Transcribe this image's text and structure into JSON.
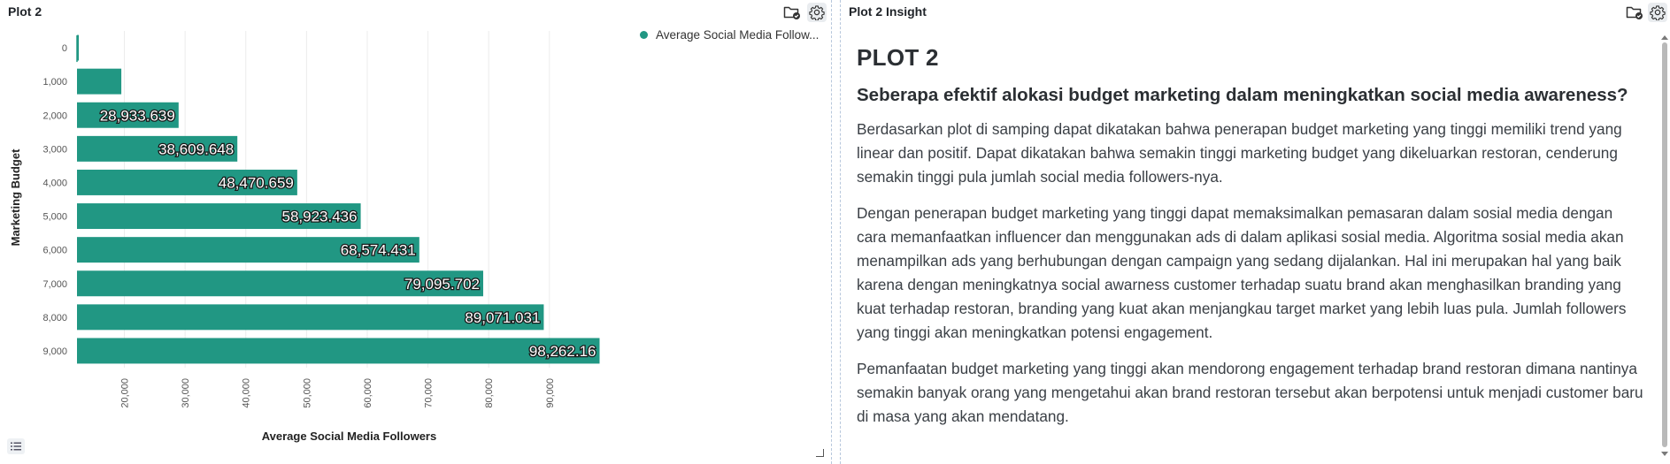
{
  "left_panel": {
    "title": "Plot 2",
    "icons": [
      "folder-check-icon",
      "gear-icon"
    ],
    "legend_label": "Average Social Media Follow...",
    "bottom_button_icon": "list-icon"
  },
  "right_panel": {
    "title": "Plot 2 Insight",
    "icons": [
      "folder-check-icon",
      "gear-icon"
    ],
    "heading": "PLOT 2",
    "question": "Seberapa efektif alokasi budget marketing dalam meningkatkan social media awareness?",
    "paragraphs": [
      "Berdasarkan plot di samping dapat dikatakan bahwa penerapan budget marketing yang tinggi memiliki trend yang linear dan positif. Dapat dikatakan bahwa semakin tinggi marketing budget yang dikeluarkan restoran, cenderung semakin tinggi pula jumlah social media followers-nya.",
      "Dengan penerapan budget marketing yang tinggi dapat memaksimalkan pemasaran dalam sosial media dengan cara memanfaatkan influencer dan menggunakan ads di dalam aplikasi sosial media. Algoritma sosial media akan menampilkan ads yang berhubungan dengan campaign yang sedang dijalankan. Hal ini merupakan hal yang baik karena dengan meningkatnya social awarness customer terhadap suatu brand akan menghasilkan branding yang kuat terhadap restoran, branding yang kuat akan menjangkau target market yang lebih luas pula. Jumlah followers yang tinggi akan meningkatkan potensi engagement.",
      "Pemanfaatan budget marketing yang tinggi akan mendorong engagement terhadap brand restoran dimana nantinya semakin banyak orang yang mengetahui akan brand restoran tersebut akan berpotensi untuk menjadi customer baru di masa yang akan mendatang."
    ]
  },
  "chart_data": {
    "type": "bar",
    "orientation": "horizontal",
    "title": "Plot 2",
    "categories": [
      "0",
      "1,000",
      "2,000",
      "3,000",
      "4,000",
      "5,000",
      "6,000",
      "7,000",
      "8,000",
      "9,000"
    ],
    "series": [
      {
        "name": "Average Social Media Follow...",
        "color": "#219783",
        "values": [
          12500,
          19500,
          28933.639,
          38609.648,
          48470.659,
          58923.436,
          68574.431,
          79095.702,
          89071.031,
          98262.16
        ],
        "data_labels": [
          "",
          "",
          "28,933.639",
          "38,609.648",
          "48,470.659",
          "58,923.436",
          "68,574.431",
          "79,095.702",
          "89,071.031",
          "98,262.16"
        ]
      }
    ],
    "xlabel": "Average Social Media Followers",
    "ylabel": "Marketing Budget",
    "x_ticks": [
      "20,000",
      "30,000",
      "40,000",
      "50,000",
      "60,000",
      "70,000",
      "80,000",
      "90,000"
    ],
    "x_tick_values": [
      20000,
      30000,
      40000,
      50000,
      60000,
      70000,
      80000,
      90000
    ],
    "xlim": [
      12200,
      103000
    ],
    "grid": true,
    "legend": "top-right"
  }
}
